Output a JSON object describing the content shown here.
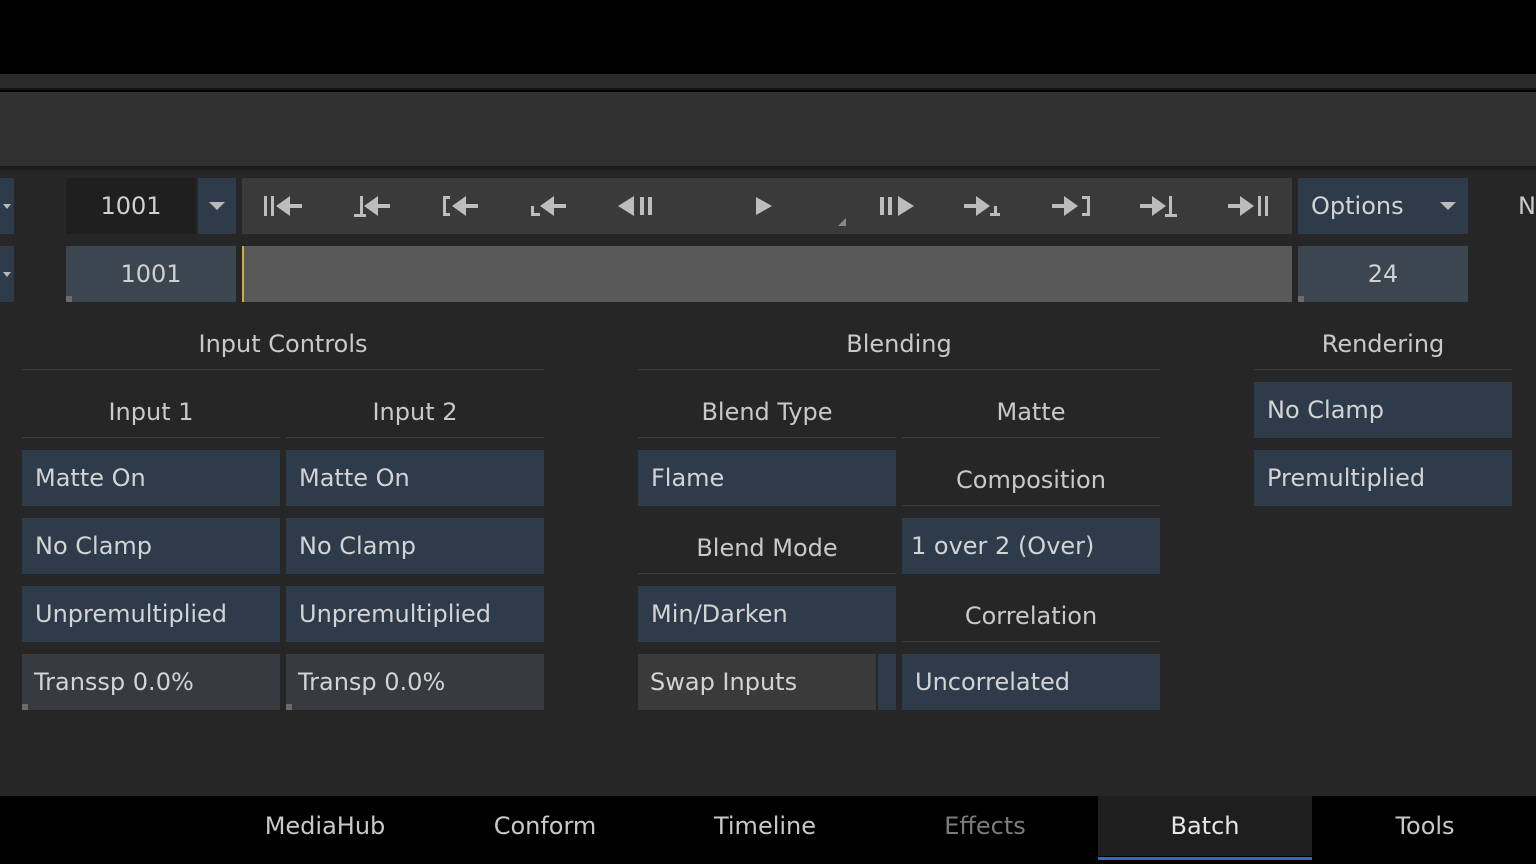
{
  "transport": {
    "current_frame": "1001",
    "start_frame": "1001",
    "options_label": "Options",
    "fps": "24",
    "cut_label": "N"
  },
  "input_controls": {
    "title": "Input Controls",
    "input1": {
      "title": "Input 1",
      "matte": "Matte On",
      "clamp": "No Clamp",
      "premult": "Unpremultiplied",
      "transp": "Transsp 0.0%"
    },
    "input2": {
      "title": "Input 2",
      "matte": "Matte On",
      "clamp": "No Clamp",
      "premult": "Unpremultiplied",
      "transp": "Transp 0.0%"
    }
  },
  "blending": {
    "title": "Blending",
    "blend_type_label": "Blend Type",
    "blend_type_value": "Flame",
    "matte_label": "Matte",
    "composition_label": "Composition",
    "composition_value": "1 over 2 (Over)",
    "blend_mode_label": "Blend Mode",
    "blend_mode_value": "Min/Darken",
    "correlation_label": "Correlation",
    "correlation_value": "Uncorrelated",
    "swap_inputs_label": "Swap Inputs"
  },
  "rendering": {
    "title": "Rendering",
    "clamp": "No Clamp",
    "premult": "Premultiplied"
  },
  "tabs": [
    {
      "label": "MediaHub"
    },
    {
      "label": "Conform"
    },
    {
      "label": "Timeline"
    },
    {
      "label": "Effects"
    },
    {
      "label": "Batch"
    },
    {
      "label": "Tools"
    }
  ],
  "active_tab": "Batch",
  "colors": {
    "button_blue": "#2d3b4b",
    "panel_bg": "#262626",
    "playhead": "#c8b040",
    "tab_underline": "#2f6db5"
  }
}
